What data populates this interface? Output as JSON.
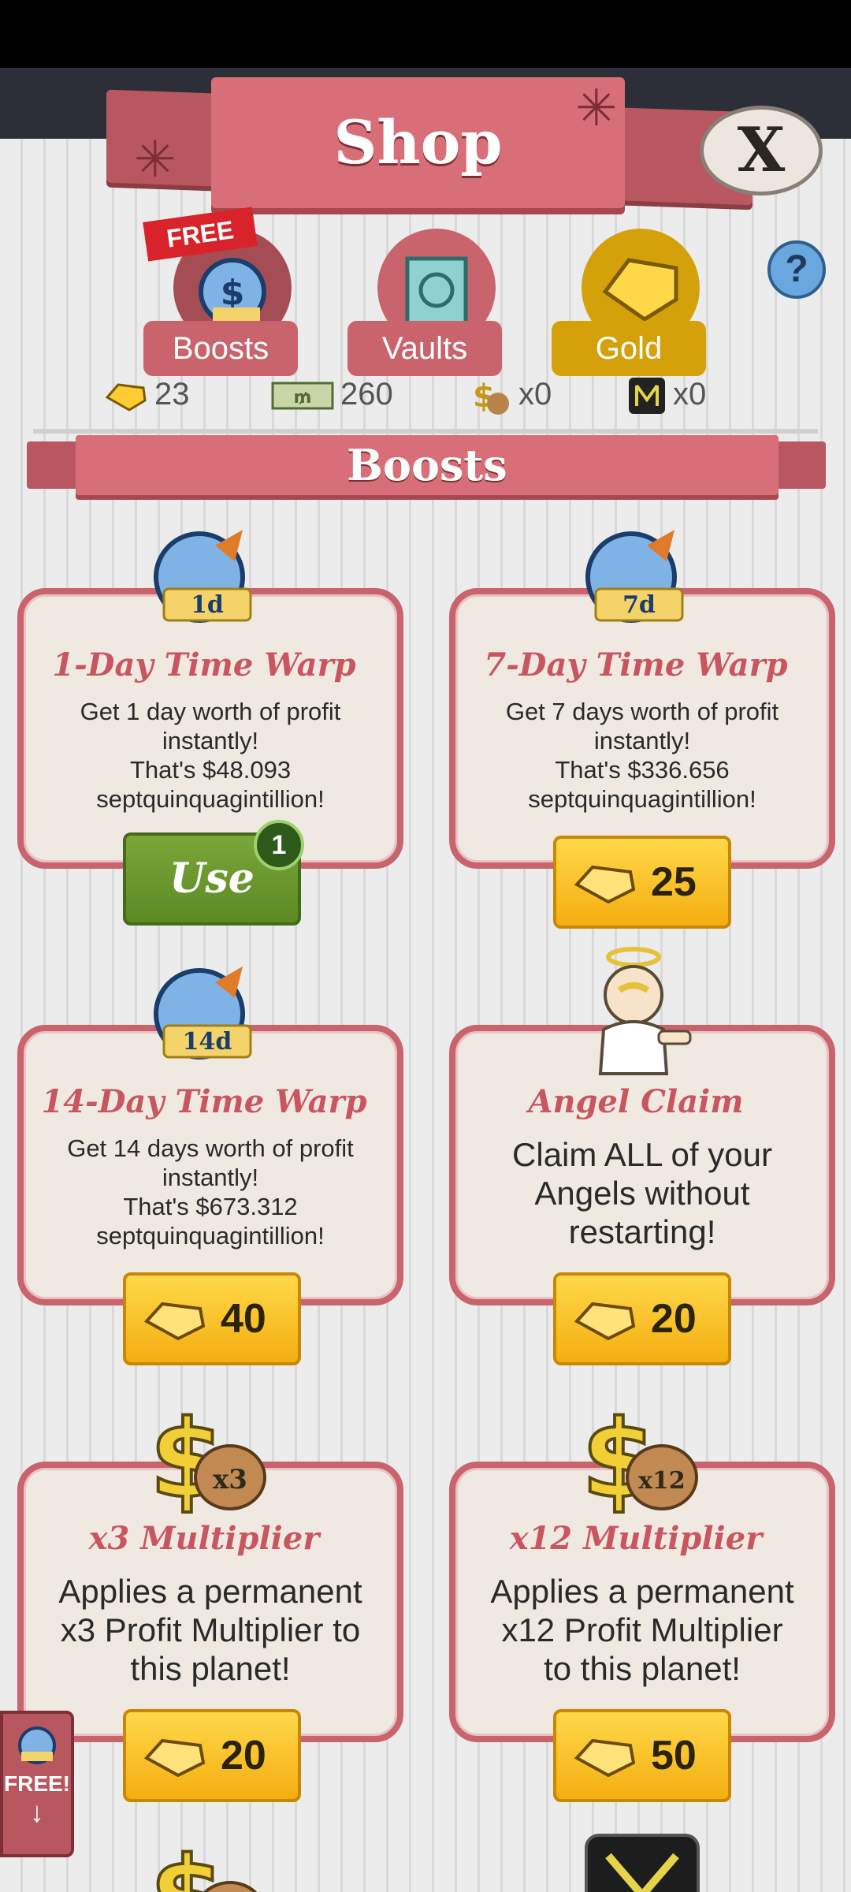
{
  "header": {
    "title": "Shop",
    "close_label": "X"
  },
  "tabs": [
    {
      "label": "Boosts",
      "free_tag": "FREE",
      "color": "#c9646c"
    },
    {
      "label": "Vaults",
      "color": "#c9646c"
    },
    {
      "label": "Gold",
      "color": "#d4a10a"
    }
  ],
  "help_label": "?",
  "currencies": [
    {
      "icon": "gold-gem-icon",
      "value": "23"
    },
    {
      "icon": "megabucks-icon",
      "value": "260"
    },
    {
      "icon": "money-bag-multiplier-icon",
      "value": "x0"
    },
    {
      "icon": "mega-ticket-icon",
      "value": "x0"
    }
  ],
  "section": {
    "title": "Boosts"
  },
  "items": [
    {
      "art_label": "1d",
      "title": "1-Day Time Warp",
      "desc_lines": [
        "Get 1 day worth of profit",
        "instantly!",
        "That's $48.093",
        "septquinquagintillion!"
      ],
      "button": {
        "type": "use",
        "label": "Use",
        "badge": "1"
      }
    },
    {
      "art_label": "7d",
      "title": "7-Day Time Warp",
      "desc_lines": [
        "Get 7 days worth of profit",
        "instantly!",
        "That's $336.656",
        "septquinquagintillion!"
      ],
      "button": {
        "type": "price",
        "label": "25"
      }
    },
    {
      "art_label": "14d",
      "title": "14-Day Time Warp",
      "desc_lines": [
        "Get 14 days worth of profit",
        "instantly!",
        "That's $673.312",
        "septquinquagintillion!"
      ],
      "button": {
        "type": "price",
        "label": "40"
      }
    },
    {
      "art_label": "",
      "title": "Angel Claim",
      "desc_lines": [
        "Claim ALL of your",
        "Angels without",
        "restarting!"
      ],
      "button": {
        "type": "price",
        "label": "20"
      }
    },
    {
      "art_label": "x3",
      "title": "x3 Multiplier",
      "desc_lines": [
        "Applies a permanent",
        "x3 Profit Multiplier to",
        "this planet!"
      ],
      "button": {
        "type": "price",
        "label": "20"
      }
    },
    {
      "art_label": "x12",
      "title": "x12 Multiplier",
      "desc_lines": [
        "Applies a permanent",
        "x12 Profit Multiplier",
        "to this planet!"
      ],
      "button": {
        "type": "price",
        "label": "50"
      }
    }
  ],
  "side_promo": {
    "label": "FREE!",
    "arrow": "↓"
  }
}
